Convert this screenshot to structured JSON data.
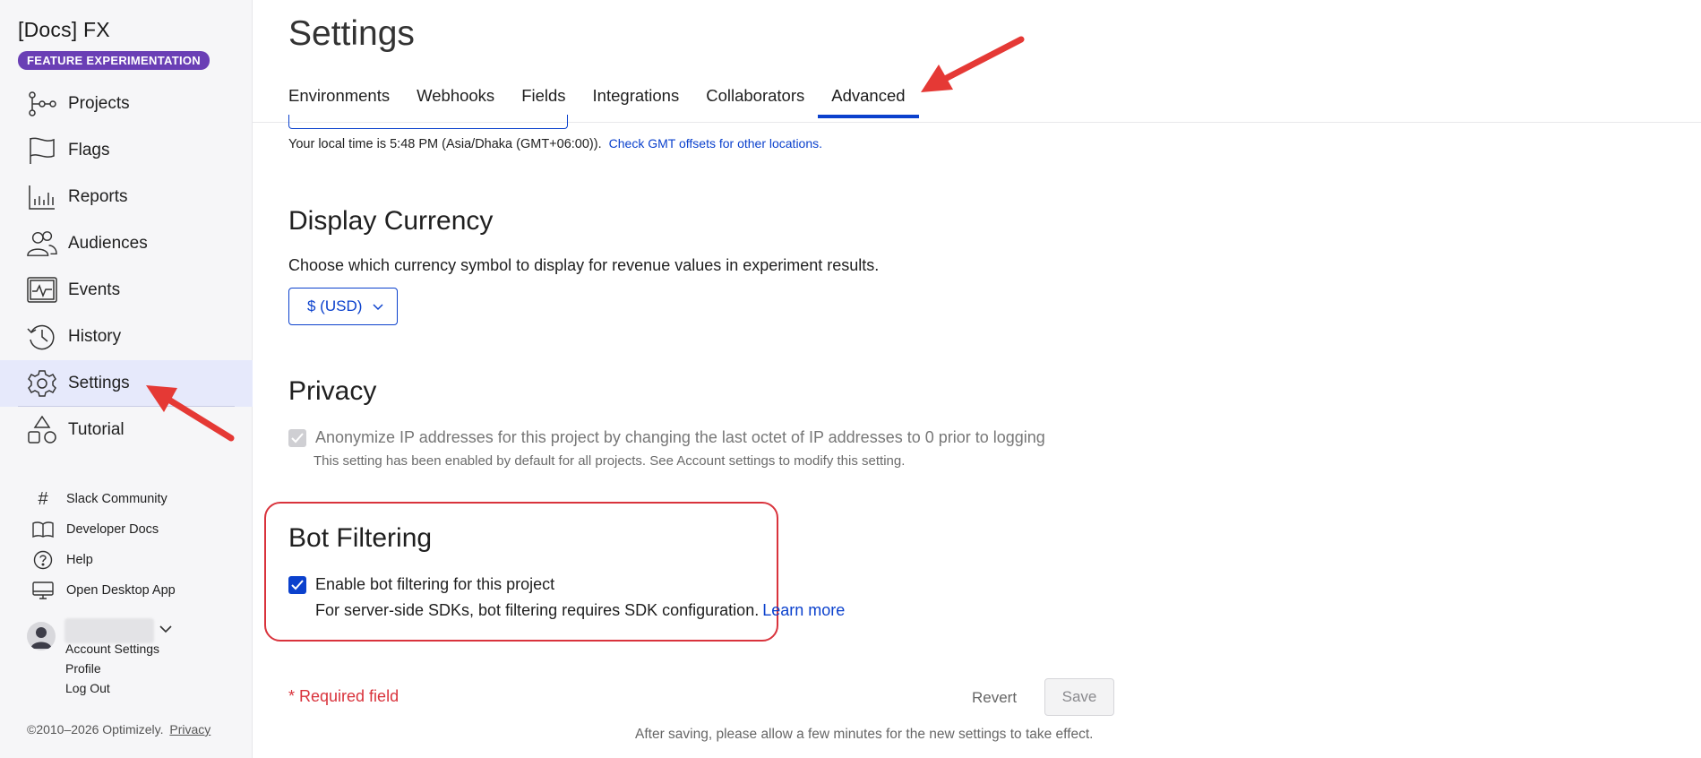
{
  "sidebar": {
    "brand": "[Docs] FX",
    "badge": "FEATURE EXPERIMENTATION",
    "nav": [
      {
        "label": "Projects",
        "icon": "projects-icon"
      },
      {
        "label": "Flags",
        "icon": "flag-icon"
      },
      {
        "label": "Reports",
        "icon": "reports-icon"
      },
      {
        "label": "Audiences",
        "icon": "audiences-icon"
      },
      {
        "label": "Events",
        "icon": "events-icon"
      },
      {
        "label": "History",
        "icon": "history-icon"
      },
      {
        "label": "Settings",
        "icon": "gear-icon",
        "active": true
      },
      {
        "label": "Tutorial",
        "icon": "tutorial-icon"
      }
    ],
    "secondary": [
      {
        "label": "Slack Community",
        "icon": "hash-icon"
      },
      {
        "label": "Developer Docs",
        "icon": "book-icon"
      },
      {
        "label": "Help",
        "icon": "help-icon"
      },
      {
        "label": "Open Desktop App",
        "icon": "desktop-icon"
      }
    ],
    "user": {
      "links": [
        "Account Settings",
        "Profile",
        "Log Out"
      ]
    },
    "footer": {
      "copyright": "©2010–2026 Optimizely.",
      "privacy": "Privacy"
    }
  },
  "main": {
    "title": "Settings",
    "tabs": [
      {
        "label": "Environments"
      },
      {
        "label": "Webhooks"
      },
      {
        "label": "Fields"
      },
      {
        "label": "Integrations"
      },
      {
        "label": "Collaborators"
      },
      {
        "label": "Advanced",
        "active": true
      }
    ],
    "local_time": {
      "text": "Your local time is 5:48 PM (Asia/Dhaka (GMT+06:00)).",
      "link": "Check GMT offsets for other locations."
    },
    "currency": {
      "heading": "Display Currency",
      "description": "Choose which currency symbol to display for revenue values in experiment results.",
      "selected": "$ (USD)"
    },
    "privacy": {
      "heading": "Privacy",
      "checkbox_label": "Anonymize IP addresses for this project by changing the last octet of IP addresses to 0 prior to logging",
      "note": "This setting has been enabled by default for all projects. See Account settings to modify this setting.",
      "checked": true,
      "disabled": true
    },
    "bot_filtering": {
      "heading": "Bot Filtering",
      "checkbox_label": "Enable bot filtering for this project",
      "note": "For server-side SDKs, bot filtering requires SDK configuration.",
      "learn_more": "Learn more",
      "checked": true
    },
    "footer": {
      "required": "* Required field",
      "revert": "Revert",
      "save": "Save",
      "after_save": "After saving, please allow a few minutes for the new settings to take effect."
    }
  },
  "colors": {
    "accent": "#0b41cd",
    "badge": "#6a3fb5",
    "annotation_red": "#d9333c"
  }
}
